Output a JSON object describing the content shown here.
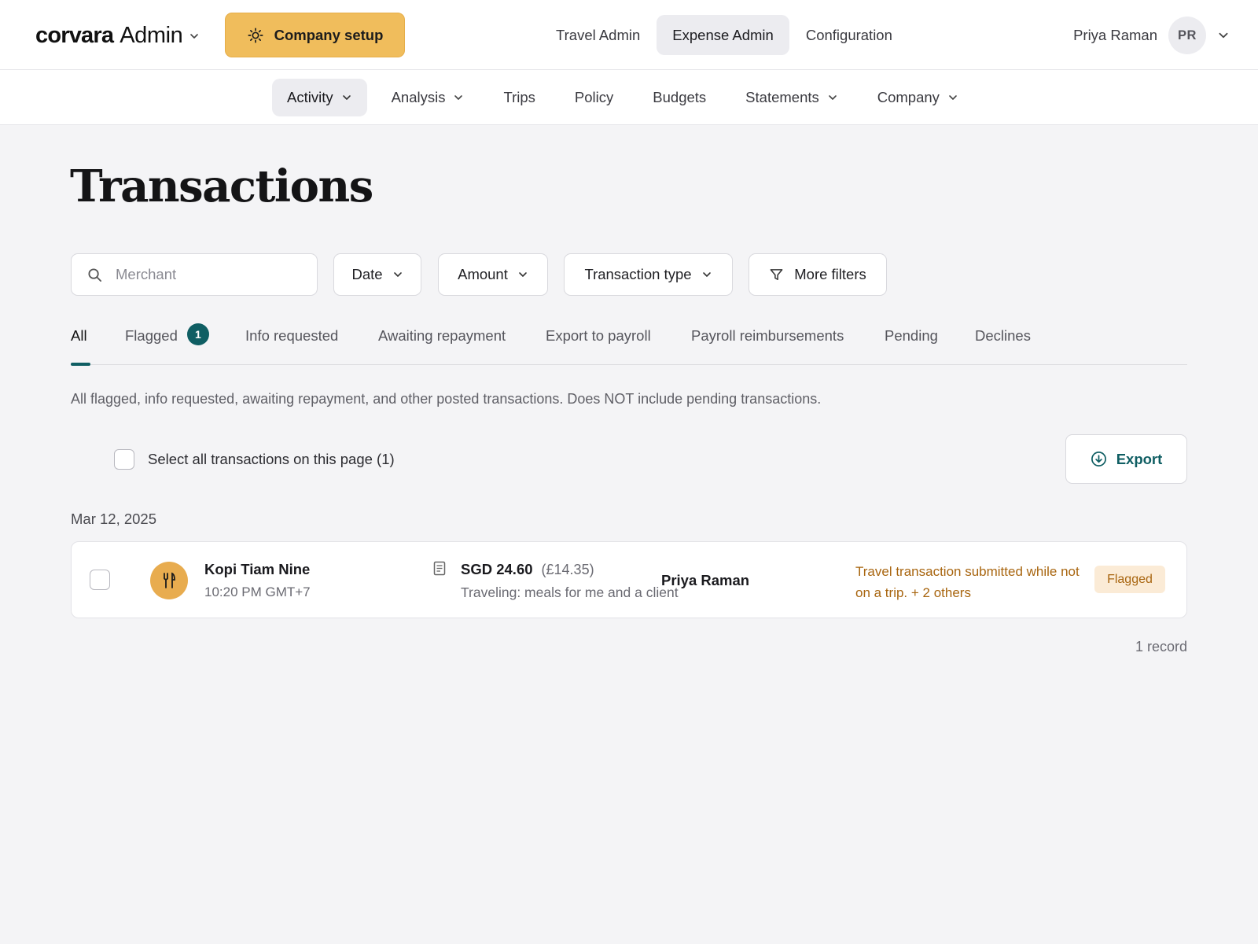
{
  "header": {
    "brand_logo": "corvara",
    "brand_suffix": "Admin",
    "setup_button": "Company setup",
    "nav": [
      "Travel Admin",
      "Expense Admin",
      "Configuration"
    ],
    "active_nav": "Expense Admin",
    "user_name": "Priya Raman",
    "user_initials": "PR",
    "icons": {
      "brand_menu": "chevron-down-icon",
      "setup": "gear-icon",
      "user_menu": "chevron-down-icon"
    }
  },
  "subnav": {
    "items": [
      {
        "label": "Activity",
        "has_menu": true,
        "active": true
      },
      {
        "label": "Analysis",
        "has_menu": true
      },
      {
        "label": "Trips"
      },
      {
        "label": "Policy"
      },
      {
        "label": "Budgets"
      },
      {
        "label": "Statements",
        "has_menu": true
      },
      {
        "label": "Company",
        "has_menu": true
      }
    ]
  },
  "page": {
    "title": "Transactions"
  },
  "filters": {
    "search_placeholder": "Merchant",
    "date": "Date",
    "amount": "Amount",
    "type": "Transaction type",
    "more": "More filters"
  },
  "tabs": {
    "items": [
      {
        "label": "All",
        "active": true
      },
      {
        "label": "Flagged",
        "badge": "1"
      },
      {
        "label": "Info requested"
      },
      {
        "label": "Awaiting repayment"
      },
      {
        "label": "Export to payroll"
      },
      {
        "label": "Payroll reimbursements"
      },
      {
        "label": "Pending"
      },
      {
        "label": "Declines"
      }
    ],
    "description": "All flagged, info requested, awaiting repayment, and other posted transactions. Does NOT include pending transactions."
  },
  "bulk": {
    "select_all_label": "Select all transactions on this page (1)",
    "export_label": "Export"
  },
  "groups": [
    {
      "date": "Mar 12, 2025",
      "transactions": [
        {
          "merchant": "Kopi Tiam Nine",
          "time": "10:20 PM GMT+7",
          "amount": "SGD 24.60",
          "converted": "(£14.35)",
          "memo": "Traveling: meals for me and a client",
          "employee": "Priya Raman",
          "flag_reason": "Travel transaction submitted while not on a trip. + 2 others",
          "status": "Flagged",
          "category_icon": "fork-knife-icon"
        }
      ]
    }
  ],
  "footer": {
    "record_count": "1 record"
  },
  "colors": {
    "accent": "#0f5e63",
    "setup_button": "#f0bd5c",
    "flag_text": "#a8650f",
    "flag_bg": "#fbebd6",
    "page_bg": "#f4f4f6"
  }
}
